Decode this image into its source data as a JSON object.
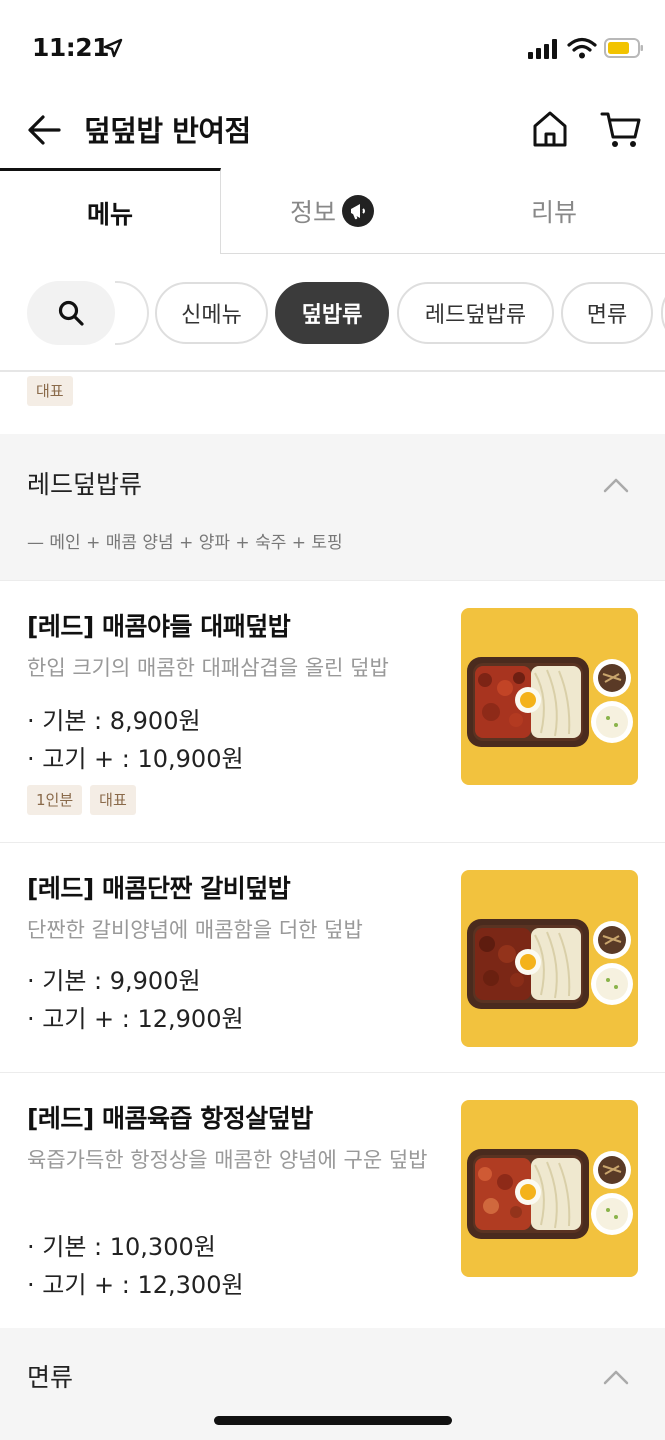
{
  "status_bar": {
    "time": "11:21"
  },
  "header": {
    "title": "덮덮밥 반여점"
  },
  "tabs": [
    {
      "label": "메뉴"
    },
    {
      "label": "정보"
    },
    {
      "label": "리뷰"
    }
  ],
  "chips": [
    "신메뉴",
    "덮밥류",
    "레드덮밥류",
    "면류"
  ],
  "active_chip": "덮밥류",
  "top_tag": "대표",
  "sections": [
    {
      "title": "레드덮밥류",
      "desc": "— 메인 + 매콤 양념 + 양파 + 숙주 + 토핑"
    },
    {
      "title": "면류"
    }
  ],
  "items": [
    {
      "name": "[레드] 매콤야들 대패덮밥",
      "desc": "한입 크기의 매콤한 대패삼겹을 올린 덮밥",
      "price_basic": "· 기본 : 8,900원",
      "price_extra": "· 고기 + : 10,900원",
      "tags": [
        "1인분",
        "대표"
      ]
    },
    {
      "name": "[레드] 매콤단짠 갈비덮밥",
      "desc": "단짠한 갈비양념에 매콤함을 더한 덮밥",
      "price_basic": "· 기본 : 9,900원",
      "price_extra": "· 고기 + : 12,900원"
    },
    {
      "name": "[레드] 매콤육즙 항정살덮밥",
      "desc": "육즙가득한 항정상을 매콤한 양념에 구운 덮밥",
      "price_basic": "· 기본 : 10,300원",
      "price_extra": "· 고기 + : 12,300원"
    }
  ],
  "colors": {
    "accent_dark": "#3b3b3b",
    "photo_bg": "#f2c23e",
    "tag_bg": "#f4ede5",
    "tag_text": "#8a6a4a"
  }
}
